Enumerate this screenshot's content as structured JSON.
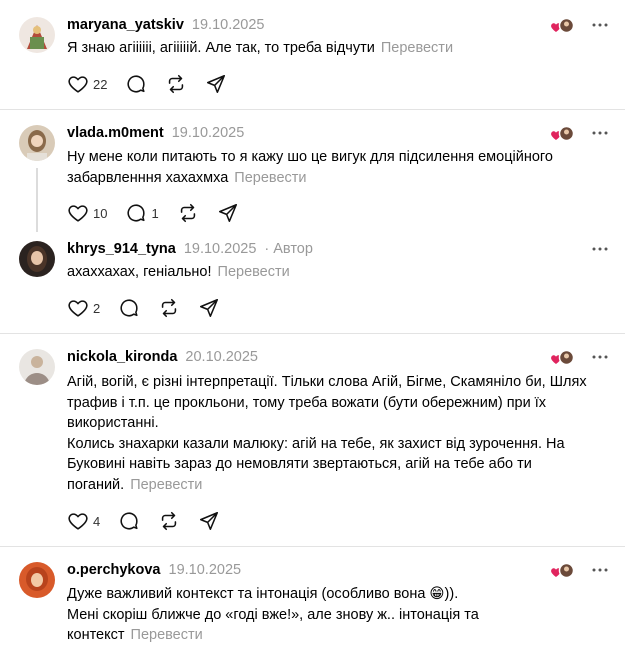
{
  "translate_label": "Перевести",
  "colors": {
    "muted": "#999999",
    "heart": "#e0245e",
    "divider": "#e3e3e3"
  },
  "posts": [
    {
      "username": "maryana_yatskiv",
      "date": "19.10.2025",
      "text": "Я знаю агіііііі, агііііій. Але так, то треба відчути",
      "likes": "22",
      "replies": "",
      "liked_by_author": true
    },
    {
      "username": "vlada.m0ment",
      "date": "19.10.2025",
      "text": "Ну мене коли питають то я кажу шо це вигук для підсилення емоційного забарвленння хахахмха",
      "likes": "10",
      "replies": "1",
      "liked_by_author": true
    },
    {
      "username": "khrys_914_tyna",
      "date": "19.10.2025",
      "author_badge": "· Автор",
      "text": "ахаххахах, геніально!",
      "likes": "2",
      "replies": "",
      "liked_by_author": false
    },
    {
      "username": "nickola_kironda",
      "date": "20.10.2025",
      "text_lines": [
        "Агій, вогій, є різні інтерпретації. Тільки слова Агій, Бігме, Скамяніло би, Шлях трафив і т.п. це прокльони, тому треба вожати (бути обережним) при їх використанні.",
        "Колись знахарки казали малюку: агій на тебе, як захист від зурочення. На Буковині навіть зараз до немовляти звертаються, агій на тебе або ти поганий."
      ],
      "likes": "4",
      "replies": "",
      "liked_by_author": true
    },
    {
      "username": "o.perchykova",
      "date": "19.10.2025",
      "text_lines": [
        "Дуже важливий контекст та інтонація (особливо вона 😁)).",
        "Мені скоріш ближче до «годі вже!», але знову ж.. інтонація та контекст"
      ],
      "likes": "",
      "replies": "",
      "liked_by_author": true
    }
  ]
}
